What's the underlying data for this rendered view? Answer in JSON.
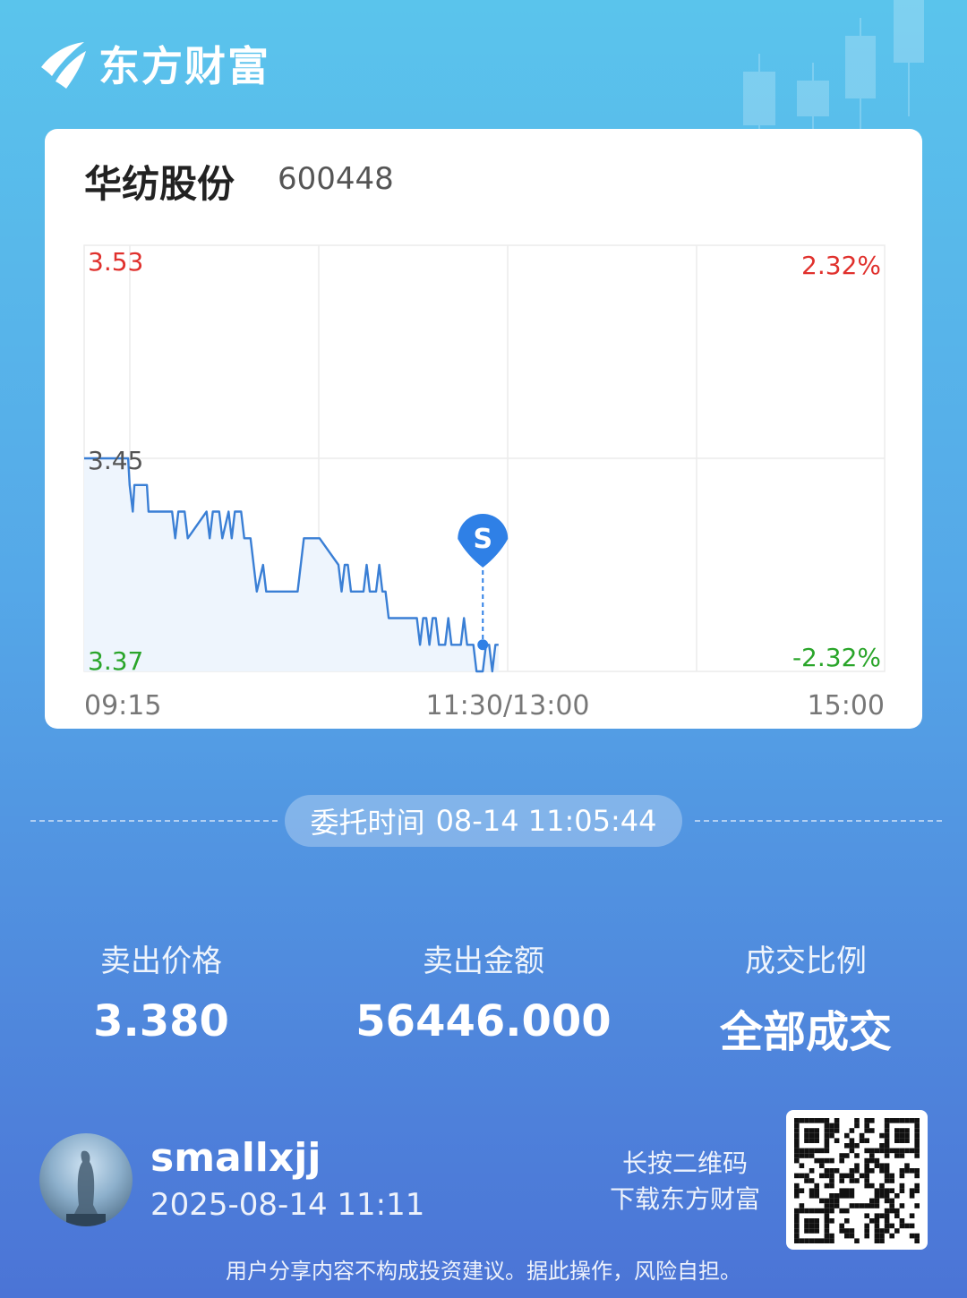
{
  "brand": {
    "name": "东方财富"
  },
  "stock": {
    "name": "华纺股份",
    "code": "600448"
  },
  "chart_data": {
    "type": "line",
    "y_ticks": [
      "3.53",
      "3.45",
      "3.37"
    ],
    "pct_ticks": [
      "2.32%",
      "-2.32%"
    ],
    "x_ticks": [
      "09:15",
      "11:30/13:00",
      "15:00"
    ],
    "ylim": [
      3.37,
      3.53
    ],
    "prev_close": 3.45,
    "x_domain": [
      0,
      255
    ],
    "series": [
      {
        "x": [
          0,
          14,
          14.5,
          15.5,
          16,
          20,
          20.5,
          21,
          28,
          29,
          30,
          32,
          33,
          39,
          40,
          41,
          43,
          44,
          46,
          47,
          48,
          50,
          51,
          53,
          54,
          55,
          57,
          58,
          59,
          63,
          63.5,
          64.5,
          65,
          68,
          69,
          70,
          75,
          81,
          82,
          83,
          84,
          85,
          89,
          90,
          91,
          93,
          94,
          95,
          96,
          97,
          99,
          100,
          101,
          102,
          103,
          106,
          107,
          108,
          109,
          110,
          111,
          112,
          113,
          115,
          116,
          117,
          120,
          121,
          122,
          124,
          125,
          127,
          128,
          129,
          130,
          131,
          132
        ],
        "y": [
          3.45,
          3.45,
          3.44,
          3.43,
          3.44,
          3.44,
          3.43,
          3.43,
          3.43,
          3.42,
          3.43,
          3.43,
          3.42,
          3.43,
          3.42,
          3.43,
          3.43,
          3.42,
          3.43,
          3.42,
          3.43,
          3.43,
          3.42,
          3.42,
          3.41,
          3.4,
          3.41,
          3.4,
          3.4,
          3.4,
          3.4,
          3.4,
          3.4,
          3.4,
          3.41,
          3.42,
          3.42,
          3.41,
          3.4,
          3.41,
          3.41,
          3.4,
          3.4,
          3.41,
          3.4,
          3.4,
          3.41,
          3.4,
          3.4,
          3.39,
          3.39,
          3.39,
          3.39,
          3.39,
          3.39,
          3.39,
          3.38,
          3.39,
          3.39,
          3.38,
          3.39,
          3.39,
          3.38,
          3.38,
          3.39,
          3.38,
          3.38,
          3.39,
          3.38,
          3.38,
          3.37,
          3.37,
          3.38,
          3.38,
          3.37,
          3.38,
          3.38
        ]
      }
    ],
    "marker": {
      "label": "S",
      "x": 127,
      "y": 3.38,
      "color": "#2f80e6"
    },
    "colors": {
      "line": "#3a7fd5",
      "up": "#e0312d",
      "down": "#2aa52a",
      "grid": "#ececec"
    }
  },
  "order": {
    "label": "委托时间",
    "value": "08-14 11:05:44"
  },
  "stats": [
    {
      "label": "卖出价格",
      "value": "3.380"
    },
    {
      "label": "卖出金额",
      "value": "56446.000"
    },
    {
      "label": "成交比例",
      "value": "全部成交"
    }
  ],
  "user": {
    "name": "smallxjj",
    "time": "2025-08-14 11:11"
  },
  "qr": {
    "tip_line1": "长按二维码",
    "tip_line2": "下载东方财富"
  },
  "disclaimer": "用户分享内容不构成投资建议。据此操作，风险自担。"
}
